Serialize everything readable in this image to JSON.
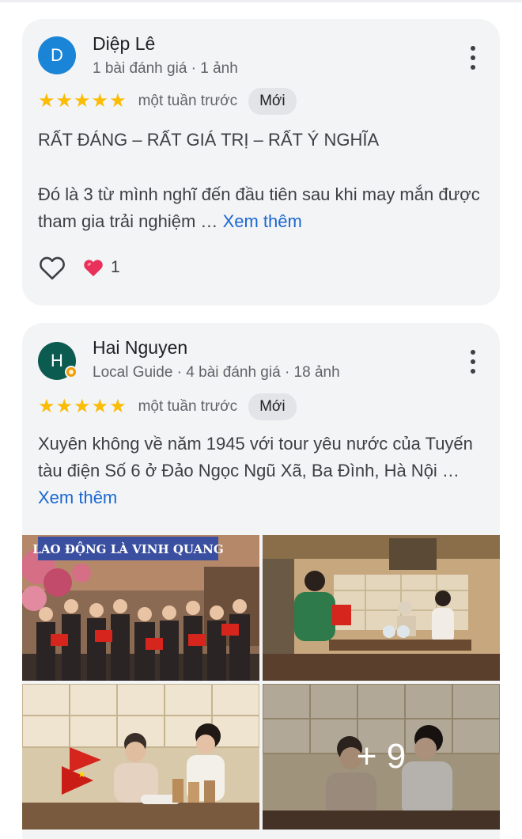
{
  "reviews": [
    {
      "avatar_letter": "D",
      "name": "Diệp Lê",
      "meta": "1 bài đánh giá · 1 ảnh",
      "stars": "★★★★★",
      "time": "một tuần trước",
      "badge": "Mới",
      "headline": "RẤT ĐÁNG – RẤT GIÁ TRỊ – RẤT Ý NGHĨA",
      "body": "Đó là 3 từ mình nghĩ đến đầu tiên sau khi may mắn được tham gia trải nghiệm …",
      "more_label": "Xem thêm",
      "like_count": "1"
    },
    {
      "avatar_letter": "H",
      "name": "Hai Nguyen",
      "meta": "Local Guide · 4 bài đánh giá · 18 ảnh",
      "stars": "★★★★★",
      "time": "một tuần trước",
      "badge": "Mới",
      "body": "Xuyên không về năm 1945 với tour yêu nước của Tuyến tàu điện Số 6 ở Đảo Ngọc Ngũ Xã, Ba Đình, Hà Nội …",
      "more_label": "Xem thêm",
      "photo_banner": "LAO ĐỘNG LÀ VINH QUANG",
      "more_photos": "+ 9"
    }
  ],
  "colors": {
    "star": "#fbbc04",
    "link": "#1a67d2",
    "card": "#f3f4f6",
    "heart": "#e8305a"
  },
  "icons": [
    "more-vert-icon",
    "heart-outline-icon",
    "heart-reaction-icon",
    "local-guide-badge-icon"
  ]
}
